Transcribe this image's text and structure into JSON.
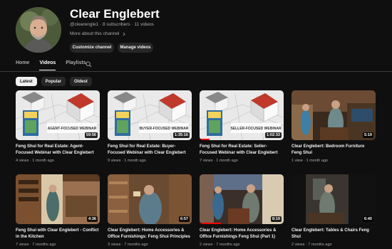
{
  "channel": {
    "name": "Clear Englebert",
    "handle": "@clearengle1",
    "subscribers": "8 subscribers",
    "videos_count": "11 videos",
    "meta_separator": "·",
    "more_label": "More about this channel",
    "customize_label": "Customize channel",
    "manage_label": "Manage videos"
  },
  "tabs": [
    {
      "label": "Home"
    },
    {
      "label": "Videos"
    },
    {
      "label": "Playlists"
    }
  ],
  "chips": [
    {
      "label": "Latest"
    },
    {
      "label": "Popular"
    },
    {
      "label": "Oldest"
    }
  ],
  "videos": [
    {
      "title": "Feng Shui for Real Estate: Agent-Focused Webinar with Clear Englebert",
      "views": "4 views",
      "age": "1 month ago",
      "duration": "59:56",
      "thumb": "webinar",
      "banner": "AGENT-FOCUSED WEBINAR",
      "progress": 0
    },
    {
      "title": "Feng Shui for Real Estate: Buyer-Focused Webinar with Clear Englebert",
      "views": "9 views",
      "age": "1 month ago",
      "duration": "1:35:16",
      "thumb": "webinar",
      "banner": "BUYER-FOCUSED WEBINAR",
      "progress": 0
    },
    {
      "title": "Feng Shui for Real Estate: Seller-Focused Webinar with Clear Englebert",
      "views": "7 views",
      "age": "1 month ago",
      "duration": "1:02:33",
      "thumb": "webinar",
      "banner": "SELLER-FOCUSED WEBINAR",
      "progress": 0.12
    },
    {
      "title": "Clear Englebert: Bedroom Furniture Feng Shui",
      "views": "1 view",
      "age": "1 month ago",
      "duration": "5:19",
      "thumb": "room",
      "banner": "",
      "progress": 0
    },
    {
      "title": "Feng Shui with Clear Englebert - Conflict in the Kitchen",
      "views": "7 views",
      "age": "7 months ago",
      "duration": "4:36",
      "thumb": "kitchen",
      "banner": "",
      "progress": 0
    },
    {
      "title": "Clear Englebert: Home Accessories & Office Furnishings: Feng Shui Principles (Part 2)",
      "views": "3 views",
      "age": "7 months ago",
      "duration": "6:57",
      "thumb": "shelf",
      "banner": "",
      "progress": 0
    },
    {
      "title": "Clear Englebert: Home Accessories & Office Furnishings Feng Shui (Part 1)",
      "views": "2 views",
      "age": "7 months ago",
      "duration": "8:19",
      "thumb": "store",
      "banner": "",
      "progress": 0.25
    },
    {
      "title": "Clear Englebert: Tables & Chairs Feng Shui",
      "views": "2 views",
      "age": "7 months ago",
      "duration": "6:40",
      "thumb": "dark",
      "banner": "",
      "progress": 0
    }
  ],
  "icons": {
    "search": "search-icon",
    "chevron": "chevron-right-icon"
  }
}
